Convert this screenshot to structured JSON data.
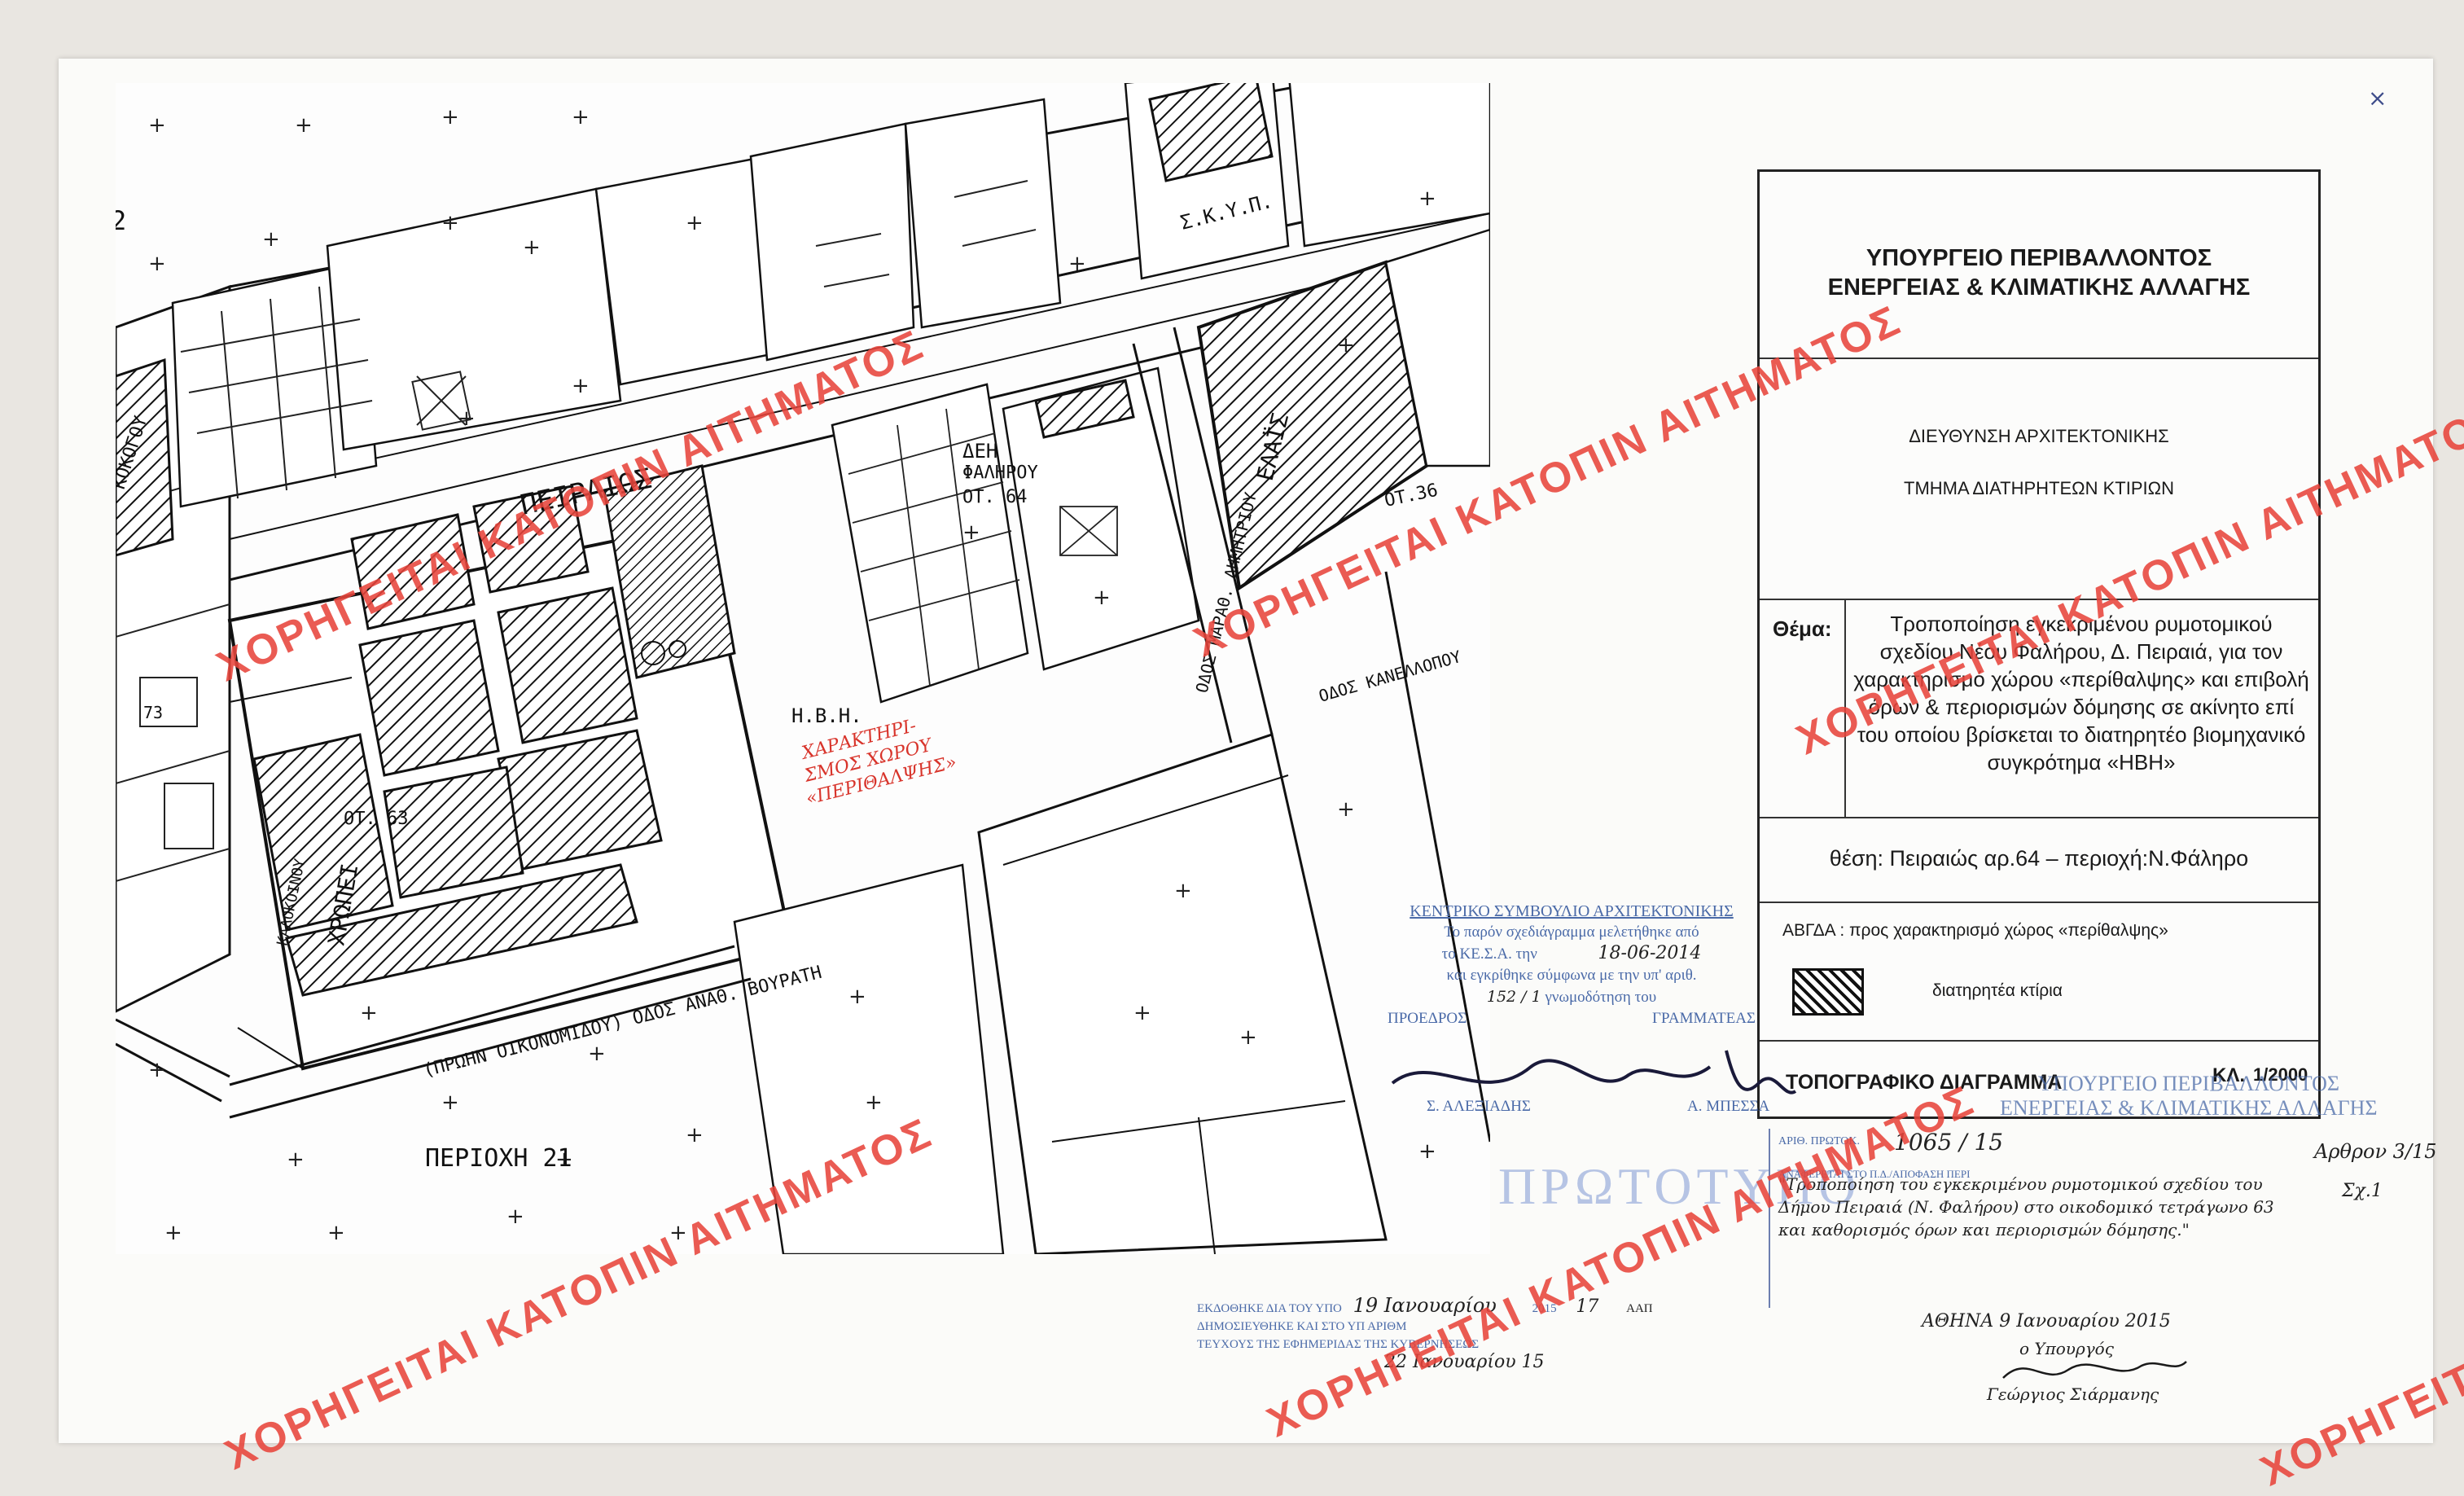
{
  "map": {
    "page_number": "2",
    "streets": {
      "peiraios": "ΠΕΙΡΑΙΩΣ",
      "xrdpei": "ΧΡΩΠΕΙ",
      "oikonomidou": "(ΠΡΩΗΝ ΟΙΚΟΝΟΜΙΔΟΥ) ΟΔΟΣ ΑΝΑΘ. ΒΟΥΡΑΤΗ",
      "marathonos": "ΟΔΟΣ ΜΑΡΑΘ. ΔΗΜΗΤΡΙΟΥ",
      "kanellopoulou": "ΟΔΟΣ ΚΑΝΕΛΛΟΠΟΥ",
      "kokogou": "ΚΟΚΟΓΟΥ",
      "kokkinou": "ΚΑΛΟΚΟΙΝΟΥ",
      "area": "ΠΕΡΙΟΧΗ  21"
    },
    "labels": {
      "skyp": "Σ.Κ.Υ.Π.",
      "elais": "ΕΛΑΪΣ",
      "ot36": "ΟΤ.36",
      "dei": "ΔΕΗ",
      "falirou": "ΦΑΛΗΡΟΥ",
      "ot64": "ΟΤ. 64",
      "ot63": "ΟΤ. 63",
      "ivi": "Η.Β.Η.",
      "num73": "73"
    },
    "red_handwriting": [
      "ΧΑΡΑΚΤΗΡΙ-",
      "ΣΜΟΣ ΧΩΡΟΥ",
      "«ΠΕΡΙΘΑΛΨΗΣ»"
    ]
  },
  "title_block": {
    "ministry_line1": "ΥΠΟΥΡΓΕΙΟ  ΠΕΡΙΒΑΛΛΟΝΤΟΣ",
    "ministry_line2": "ΕΝΕΡΓΕΙΑΣ & ΚΛΙΜΑΤΙΚΗΣ ΑΛΛΑΓΗΣ",
    "directorate": "ΔΙΕΥΘΥΝΣΗ ΑΡΧΙΤΕΚΤΟΝΙΚΗΣ",
    "department": "ΤΜΗΜΑ ΔΙΑΤΗΡΗΤΕΩΝ ΚΤΙΡΙΩΝ",
    "subject_label": "Θέμα:",
    "subject_text": "Τροποποίηση εγκεκριμένου ρυμοτομικού σχεδίου Νέου Φαλήρου, Δ. Πειραιά, για τον χαρακτηρισμό χώρου «περίθαλψης» και επιβολή όρων & περιορισμών δόμησης σε ακίνητο επί του οποίου βρίσκεται το διατηρητέο βιομηχανικό συγκρότημα «ΗΒΗ»",
    "location": "θέση: Πειραιώς αρ.64 – περιοχή:Ν.Φάληρο",
    "legend_abgda": "ΑΒΓΔΑ :  προς χαρακτηρισμό χώρος «περίθαλψης»",
    "legend_hatch": "διατηρητέα κτίρια",
    "diagram_type": "ΤΟΠΟΓΡΑΦΙΚΟ ΔΙΑΓΡΑΜΜΑ",
    "scale_label": "ΚΛ.",
    "scale_value": "1/2000"
  },
  "stamps": {
    "kesa_title": "ΚΕΝΤΡΙΚΟ ΣΥΜΒΟΥΛΙΟ ΑΡΧΙΤΕΚΤΟΝΙΚΗΣ",
    "kesa_line1": "Το παρόν σχεδιάγραμμα μελετήθηκε από",
    "kesa_line2": "το ΚΕ.Σ.Α. την",
    "kesa_date": "18-06-2014",
    "kesa_line3": "και εγκρίθηκε σύμφωνα με την υπ' αριθ.",
    "kesa_num": "152 / 1",
    "kesa_line4": "γνωμοδότηση του",
    "president": "ΠΡΟΕΔΡΟΣ",
    "secretary": "ΓΡΑΜΜΑΤΕΑΣ",
    "president_name": "Σ. ΑΛΕΞΙΑΔΗΣ",
    "secretary_name": "Α. ΜΠΕΣΣΑ",
    "ministry_stamp1": "ΥΠΟΥΡΓΕΙΟ ΠΕΡΙΒΑΛΛΟΝΤΟΣ",
    "ministry_stamp2": "ΕΝΕΡΓΕΙΑΣ & ΚΛΙΜΑΤΙΚΗΣ ΑΛΛΑΓΗΣ",
    "original": "ΠΡΩΤΟΤΥΠΟ",
    "protocol_label": "ΑΡΙΘ. ΠΡΩΤΟΚ.",
    "protocol_num": "1065 / 15",
    "decree_label": "ΑΝΑΦΕΡΕΤΑΙ ΣΤΟ Π.Δ./ΑΠΟΦΑΣΗ ΠΕΡΙ",
    "decree_hand": "\"Τροποποίηση του εγκεκριμένου ρυμοτομικού σχεδίου του Δήμου Πειραιά (Ν. Φαλήρου) στο οικοδομικό τετράγωνο 63 και καθορισμός όρων και περιορισμών δόμησης.\"",
    "article_ref": "Αρθρον 3/15",
    "fig_ref": "Σχ.1",
    "athens_date": "ΑΘΗΝΑ  9 Ιανουαρίου 2015",
    "minister": "ο Υπουργός",
    "signature_name": "Γεώργιος Σιάρμανης",
    "publish_label": "ΕΚΔΟΘΗΚΕ ΔΙΑ ΤΟΥ ΥΠΟ",
    "publish_date_hand": "19 Ιανουαρίου",
    "publish_year": "2015",
    "publish_num": "17",
    "publish_series": "ΑΑΠ",
    "publish_line2": "ΔΗΜΟΣΙΕΥΘΗΚΕ ΚΑΙ ΣΤΟ ΥΠ ΑΡΙΘΜ",
    "publish_line3": "ΤΕΥΧΟΥΣ ΤΗΣ ΕΦΗΜΕΡΙΔΑΣ ΤΗΣ ΚΥΒΕΡΝΗΣΕΩΣ",
    "publish_date2": "22 Ιανουαρίου 15",
    "corner_mark": "×"
  },
  "watermark_text": "ΧΟΡΗΓΕΙΤΑΙ ΚΑΤΟΠΙΝ ΑΙΤΗΜΑΤΟΣ",
  "colors": {
    "watermark": "#e8453c",
    "stamp_blue": "#4a6aa8",
    "ink": "#1a1a1a"
  }
}
